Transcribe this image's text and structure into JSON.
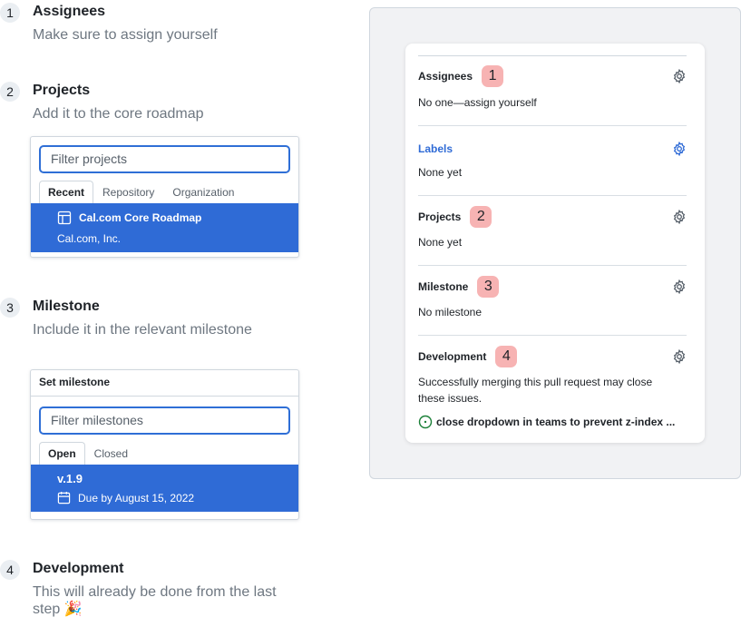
{
  "steps": [
    {
      "number": "1",
      "title": "Assignees",
      "description": "Make sure to assign yourself"
    },
    {
      "number": "2",
      "title": "Projects",
      "description": "Add it to the core roadmap"
    },
    {
      "number": "3",
      "title": "Milestone",
      "description": "Include it in the relevant milestone"
    },
    {
      "number": "4",
      "title": "Development",
      "description": "This will already be done from the last step 🎉"
    }
  ],
  "projects_panel": {
    "filter_placeholder": "Filter projects",
    "tabs": [
      "Recent",
      "Repository",
      "Organization"
    ],
    "active_tab": "Recent",
    "selected_item": {
      "title": "Cal.com Core Roadmap",
      "subtitle": "Cal.com, Inc.",
      "icon": "table-icon"
    }
  },
  "milestone_panel": {
    "header": "Set milestone",
    "filter_placeholder": "Filter milestones",
    "tabs": [
      "Open",
      "Closed"
    ],
    "active_tab": "Open",
    "selected_item": {
      "title": "v.1.9",
      "due": "Due by August 15, 2022",
      "icon": "calendar-icon"
    }
  },
  "sidebar": {
    "sections": [
      {
        "title": "Assignees",
        "badge": "1",
        "body": "No one—assign yourself",
        "link_style": false
      },
      {
        "title": "Labels",
        "badge": "",
        "body": "None yet",
        "link_style": true
      },
      {
        "title": "Projects",
        "badge": "2",
        "body": "None yet",
        "link_style": false
      },
      {
        "title": "Milestone",
        "badge": "3",
        "body": "No milestone",
        "link_style": false
      },
      {
        "title": "Development",
        "badge": "4",
        "body": "Successfully merging this pull request may close these issues.",
        "link_style": false
      }
    ],
    "development_issue": "close dropdown in teams to prevent z-index ...",
    "icons": {
      "settings": "gear-icon",
      "issue": "issue-open-icon"
    }
  },
  "colors": {
    "accent": "#2f6bd6",
    "badge": "#f7b3b3",
    "frame": "#f1f2f4",
    "issue_open": "#1a7f37"
  }
}
